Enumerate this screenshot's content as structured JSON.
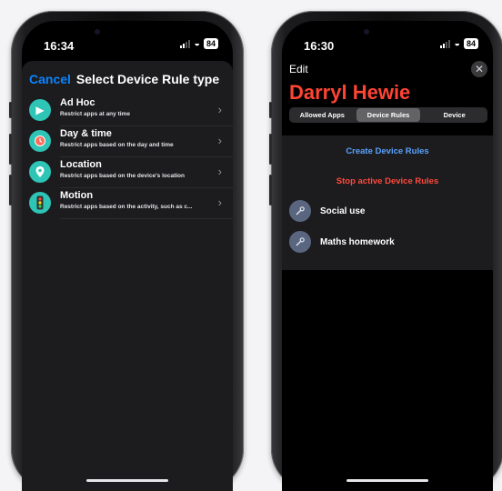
{
  "left_phone": {
    "status": {
      "time": "16:34",
      "battery": "84"
    },
    "sheet": {
      "cancel_label": "Cancel",
      "title": "Select Device Rule type",
      "rules": [
        {
          "title": "Ad Hoc",
          "subtitle": "Restrict apps at any time",
          "icon": "play-icon"
        },
        {
          "title": "Day & time",
          "subtitle": "Restrict apps based on the day and time",
          "icon": "clock-icon"
        },
        {
          "title": "Location",
          "subtitle": "Restrict apps based on the device's location",
          "icon": "location-pin-icon"
        },
        {
          "title": "Motion",
          "subtitle": "Restrict apps based on the activity, such as c...",
          "icon": "traffic-light-icon"
        }
      ]
    }
  },
  "right_phone": {
    "status": {
      "time": "16:30",
      "battery": "84"
    },
    "edit_label": "Edit",
    "name": "Darryl Hewie",
    "tabs": [
      {
        "label": "Allowed Apps",
        "selected": false
      },
      {
        "label": "Device Rules",
        "selected": true
      },
      {
        "label": "Device",
        "selected": false
      }
    ],
    "create_label": "Create Device Rules",
    "stop_label": "Stop active Device Rules",
    "rules_list": [
      {
        "label": "Social use",
        "icon": "wrench-icon"
      },
      {
        "label": "Maths homework",
        "icon": "wrench-icon"
      }
    ]
  },
  "colors": {
    "accent_blue": "#0a84ff",
    "destructive_red": "#ff4a3d",
    "name_red": "#ff4433",
    "rule_icon_teal": "#2ec4b6",
    "background": "#000000",
    "card": "#1c1c1e"
  }
}
